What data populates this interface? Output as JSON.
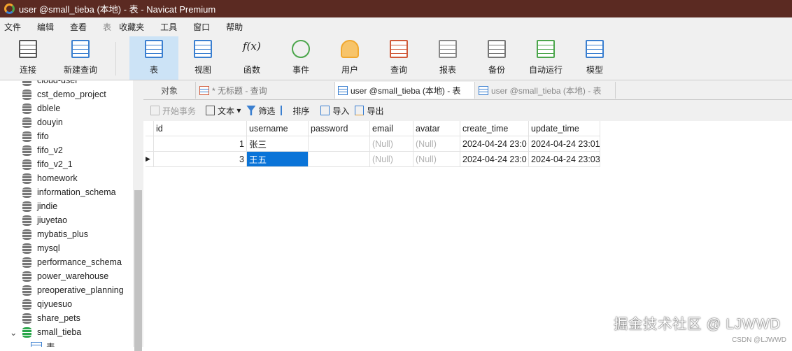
{
  "window": {
    "title": "user @small_tieba (本地) - 表 - Navicat Premium"
  },
  "menu": [
    "文件",
    "编辑",
    "查看",
    "表",
    "收藏夹",
    "工具",
    "窗口",
    "帮助"
  ],
  "toolbar": [
    {
      "label": "连接",
      "icon": "connect-icon"
    },
    {
      "label": "新建查询",
      "icon": "new-query-icon"
    },
    {
      "label": "表",
      "icon": "table-icon"
    },
    {
      "label": "视图",
      "icon": "view-icon"
    },
    {
      "label": "函数",
      "icon": "function-icon"
    },
    {
      "label": "事件",
      "icon": "event-icon"
    },
    {
      "label": "用户",
      "icon": "user-icon"
    },
    {
      "label": "查询",
      "icon": "query-icon"
    },
    {
      "label": "报表",
      "icon": "report-icon"
    },
    {
      "label": "备份",
      "icon": "backup-icon"
    },
    {
      "label": "自动运行",
      "icon": "automation-icon"
    },
    {
      "label": "模型",
      "icon": "model-icon"
    }
  ],
  "sidebar": {
    "items": [
      "cloud-user",
      "cst_demo_project",
      "dblele",
      "douyin",
      "fifo",
      "fifo_v2",
      "fifo_v2_1",
      "homework",
      "information_schema",
      "jindie",
      "jiuyetao",
      "mybatis_plus",
      "mysql",
      "performance_schema",
      "power_warehouse",
      "preoperative_planning",
      "qiyuesuo",
      "share_pets",
      "small_tieba"
    ],
    "child": "表"
  },
  "tabs": [
    "对象",
    "* 无标题 - 查询",
    "user @small_tieba (本地) - 表",
    "user @small_tieba (本地) - 表"
  ],
  "subtoolbar": {
    "begin": "开始事务",
    "text": "文本",
    "filter": "筛选",
    "sort": "排序",
    "import": "导入",
    "export": "导出"
  },
  "grid": {
    "columns": [
      "id",
      "username",
      "password",
      "email",
      "avatar",
      "create_time",
      "update_time"
    ],
    "rows": [
      [
        "1",
        "张三",
        "",
        "(Null)",
        "(Null)",
        "2024-04-24 23:0",
        "2024-04-24 23:01"
      ],
      [
        "3",
        "王五",
        "",
        "(Null)",
        "(Null)",
        "2024-04-24 23:0",
        "2024-04-24 23:03"
      ]
    ]
  },
  "watermark": {
    "main": "掘金技术社区 @ LJWWD",
    "sub": "CSDN @LJWWD"
  }
}
